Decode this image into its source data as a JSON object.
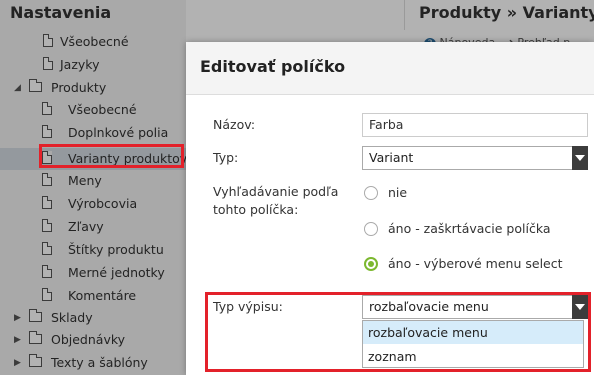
{
  "sidebar": {
    "title": "Nastavenia",
    "items": [
      {
        "label": "Všeobecné",
        "type": "doc"
      },
      {
        "label": "Jazyky",
        "type": "doc"
      },
      {
        "label": "Produkty",
        "type": "folder-open"
      },
      {
        "label": "Všeobecné",
        "type": "doc"
      },
      {
        "label": "Doplnkové polia",
        "type": "doc"
      },
      {
        "label": "Varianty produktov",
        "type": "doc",
        "selected": true
      },
      {
        "label": "Meny",
        "type": "doc"
      },
      {
        "label": "Výrobcovia",
        "type": "doc"
      },
      {
        "label": "Zľavy",
        "type": "doc"
      },
      {
        "label": "Štítky produktu",
        "type": "doc"
      },
      {
        "label": "Merné jednotky",
        "type": "doc"
      },
      {
        "label": "Komentáre",
        "type": "doc"
      },
      {
        "label": "Sklady",
        "type": "folder"
      },
      {
        "label": "Objednávky",
        "type": "folder"
      },
      {
        "label": "Texty a šablóny",
        "type": "folder"
      }
    ]
  },
  "main": {
    "title": "Produkty » Varianty",
    "sub_left": "Nápoveda",
    "sub_right": "Prehľad p"
  },
  "dialog": {
    "title": "Editovať políčko",
    "name_label": "Názov:",
    "name_value": "Farba",
    "type_label": "Typ:",
    "type_value": "Variant",
    "search_label_line1": "Vyhľadávanie podľa",
    "search_label_line2": "tohto políčka:",
    "radio_options": [
      {
        "label": "nie",
        "checked": false
      },
      {
        "label": "áno - zaškrtávacie políčka",
        "checked": false
      },
      {
        "label": "áno - výberové menu select",
        "checked": true
      }
    ],
    "list_type_label": "Typ výpisu:",
    "list_type_value": "rozbaľovacie menu",
    "list_type_options": [
      "rozbaľovacie menu",
      "zoznam"
    ]
  },
  "colors": {
    "highlight": "#e3212a",
    "radio_checked": "#7cb82f",
    "option_active": "#d6ecfa"
  }
}
